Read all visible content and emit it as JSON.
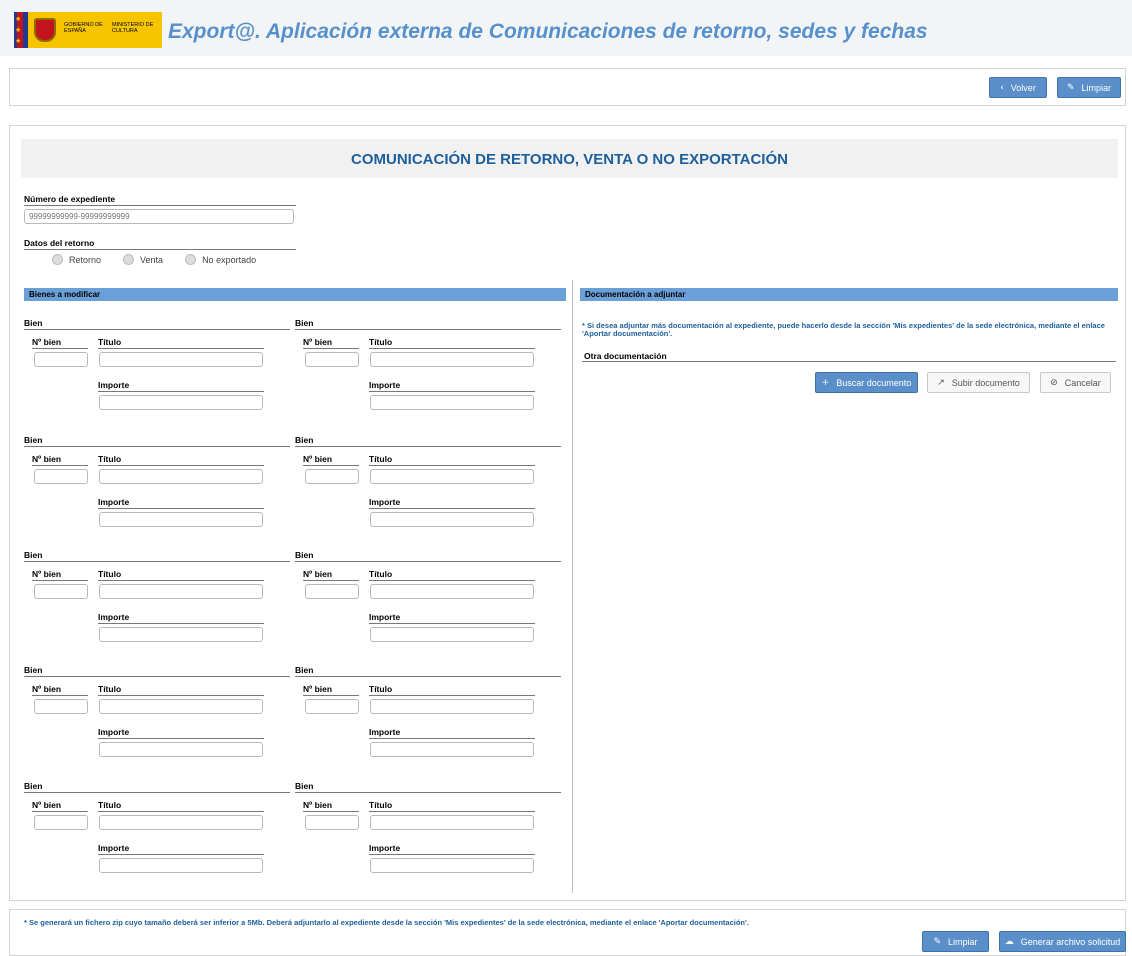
{
  "header": {
    "logo_gobierno": "GOBIERNO DE ESPAÑA",
    "logo_ministerio": "MINISTERIO DE CULTURA",
    "app_title": "Export@. Aplicación externa de Comunicaciones de retorno, sedes y fechas"
  },
  "toolbar": {
    "volver": "Volver",
    "limpiar": "Limpiar"
  },
  "form": {
    "title": "COMUNICACIÓN DE RETORNO, VENTA O NO EXPORTACIÓN",
    "expediente_label": "Número de expediente",
    "expediente_placeholder": "99999999999-99999999999",
    "datos_label": "Datos del retorno",
    "radios": [
      "Retorno",
      "Venta",
      "No exportado"
    ]
  },
  "bienes": {
    "section_title": "Bienes a modificar",
    "bien_label": "Bien",
    "nbien_label": "Nº bien",
    "titulo_label": "Título",
    "importe_label": "Importe",
    "count": 10
  },
  "docs": {
    "section_title": "Documentación a adjuntar",
    "note": "* Si desea adjuntar más documentación al expediente, puede hacerlo desde la sección 'Mis expedientes' de la sede electrónica, mediante el enlace 'Aportar documentación'.",
    "otra_label": "Otra documentación",
    "buscar": "Buscar documento",
    "subir": "Subir documento",
    "cancelar": "Cancelar"
  },
  "footer": {
    "note": "* Se generará un fichero zip cuyo tamaño deberá ser inferior a 5Mb. Deberá adjuntarlo al expediente desde la sección 'Mis expedientes' de la sede electrónica, mediante el enlace 'Aportar documentación'.",
    "limpiar": "Limpiar",
    "generar": "Generar archivo solicitud"
  }
}
